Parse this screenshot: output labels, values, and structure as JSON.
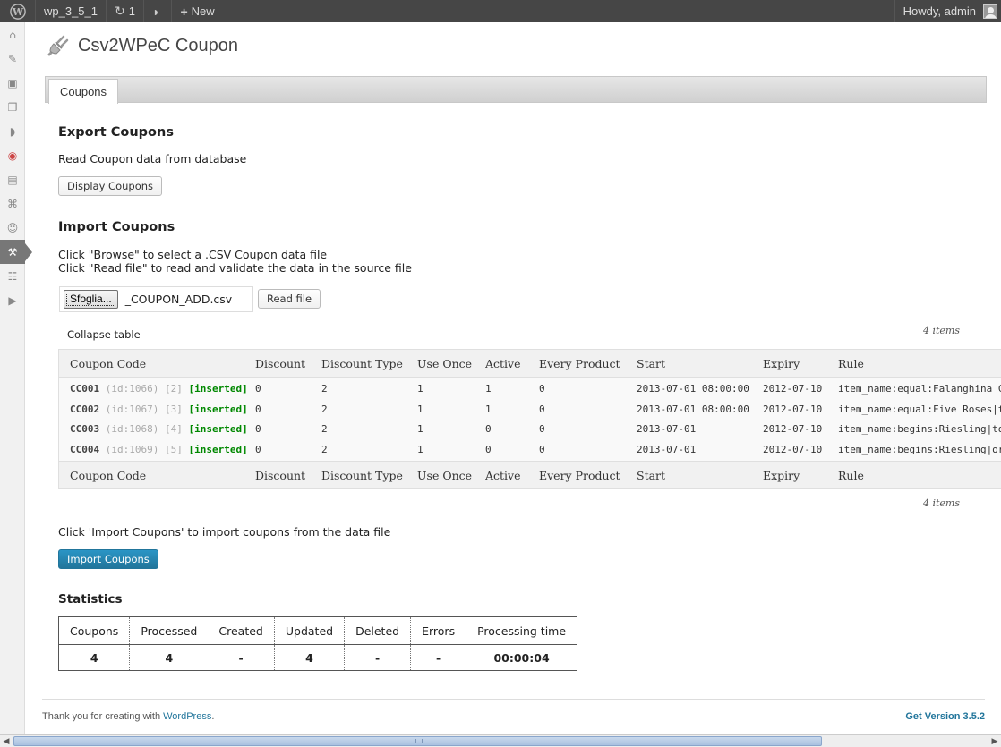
{
  "admin_bar": {
    "site_name": "wp_3_5_1",
    "updates_count": "1",
    "new_label": "New",
    "howdy": "Howdy, admin"
  },
  "page": {
    "title": "Csv2WPeC Coupon",
    "tab": "Coupons"
  },
  "export": {
    "heading": "Export Coupons",
    "description": "Read Coupon data from database",
    "button": "Display Coupons"
  },
  "import": {
    "heading": "Import Coupons",
    "line1": "Click \"Browse\" to select a .CSV Coupon data file",
    "line2": "Click \"Read file\" to read and validate the data in the source file",
    "browse_button": "Sfoglia...",
    "file_name": "_COUPON_ADD.csv",
    "read_button": "Read file",
    "items_count": "4 items",
    "collapse": "Collapse table",
    "import_text": "Click 'Import Coupons' to import coupons from the data file",
    "import_button": "Import Coupons"
  },
  "coupon_table": {
    "columns": [
      "Coupon Code",
      "Discount",
      "Discount Type",
      "Use Once",
      "Active",
      "Every Product",
      "Start",
      "Expiry",
      "Rule"
    ],
    "rows": [
      {
        "code": "CC001",
        "id": "(id:1066)",
        "index": "[2]",
        "status": "[inserted]",
        "discount": "0",
        "type": "2",
        "use_once": "1",
        "active": "1",
        "every_product": "0",
        "start": "2013-07-01 08:00:00",
        "expiry": "2012-07-10",
        "rule": "item_name:equal:Falanghina Cl"
      },
      {
        "code": "CC002",
        "id": "(id:1067)",
        "index": "[3]",
        "status": "[inserted]",
        "discount": "0",
        "type": "2",
        "use_once": "1",
        "active": "1",
        "every_product": "0",
        "start": "2013-07-01 08:00:00",
        "expiry": "2012-07-10",
        "rule": "item_name:equal:Five Roses|to"
      },
      {
        "code": "CC003",
        "id": "(id:1068)",
        "index": "[4]",
        "status": "[inserted]",
        "discount": "0",
        "type": "2",
        "use_once": "1",
        "active": "0",
        "every_product": "0",
        "start": "2013-07-01",
        "expiry": "2012-07-10",
        "rule": "item_name:begins:Riesling|tota"
      },
      {
        "code": "CC004",
        "id": "(id:1069)",
        "index": "[5]",
        "status": "[inserted]",
        "discount": "0",
        "type": "2",
        "use_once": "1",
        "active": "0",
        "every_product": "0",
        "start": "2013-07-01",
        "expiry": "2012-07-10",
        "rule": "item_name:begins:Riesling|or:i"
      }
    ]
  },
  "statistics": {
    "heading": "Statistics",
    "columns": [
      "Coupons",
      "Processed",
      "Created",
      "Updated",
      "Deleted",
      "Errors",
      "Processing time"
    ],
    "values": [
      "4",
      "4",
      "-",
      "4",
      "-",
      "-",
      "00:00:04"
    ]
  },
  "footer": {
    "thanks_prefix": "Thank you for creating with ",
    "wordpress_link": "WordPress",
    "thanks_suffix": ".",
    "version": "Get Version 3.5.2"
  },
  "icons": [
    "wordpress-logo-icon",
    "updates-icon",
    "comments-icon",
    "plus-icon",
    "dashboard-icon",
    "posts-icon",
    "media-icon",
    "pages-icon",
    "comments-menu-icon",
    "wpec-icon",
    "appearance-icon",
    "plugins-icon",
    "users-icon",
    "tools-icon",
    "settings-icon",
    "collapse-icon",
    "plugin-plug-icon"
  ]
}
